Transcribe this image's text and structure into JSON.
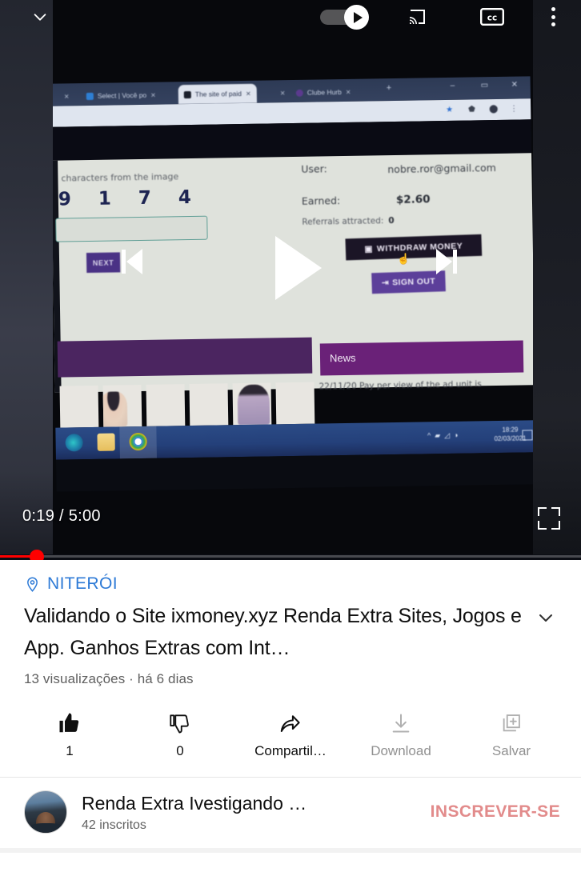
{
  "player": {
    "collapse_icon": "chevron-down-icon",
    "autoplay_label": "autoplay-toggle",
    "cast_icon": "cast-icon",
    "cc_icon": "closed-captions-icon",
    "more_icon": "more-options-icon",
    "prev_icon": "previous-video-icon",
    "play_icon": "play-icon",
    "next_icon": "next-video-icon",
    "current_time": "0:19",
    "duration": "5:00",
    "time_display": "0:19 / 5:00",
    "progress_percent": 6.4,
    "progress_color": "#ff0000",
    "fullscreen_icon": "fullscreen-icon"
  },
  "video_content": {
    "browser": {
      "tabs": [
        {
          "title": "Select | Você po",
          "favicon_color": "#2e7fd4"
        },
        {
          "title": "The site of paid",
          "favicon_color": "#1b1f2b",
          "active": true
        },
        {
          "title": "Clube Hurb",
          "favicon_color": "#5b3a8e"
        }
      ],
      "new_tab_label": "+",
      "window_buttons": [
        "–",
        "❐",
        "✕"
      ],
      "toolbar_icons": [
        "star-icon",
        "extensions-icon",
        "profile-icon",
        "menu-icon"
      ]
    },
    "site": {
      "captcha_prompt": "characters from the image",
      "captcha_digits": "9 1 7 4",
      "next_button": "NEXT",
      "user_label": "User:",
      "user_value": "nobre.ror@gmail.com",
      "earned_label": "Earned:",
      "earned_value": "$2.60",
      "referrals_label": "Referrals attracted:",
      "referrals_value": "0",
      "withdraw_button": "WITHDRAW MONEY",
      "signout_button": "SIGN OUT",
      "news_header": "News",
      "news_text": "22/11/20 Pay per view of the ad unit is"
    },
    "taskbar": {
      "apps": [
        "edge-icon",
        "file-explorer-icon",
        "chrome-icon"
      ],
      "clock_time": "18:29",
      "clock_date": "02/03/2021"
    }
  },
  "meta": {
    "location_icon": "location-pin-icon",
    "location": "NITERÓI",
    "title": "Validando o Site ixmoney.xyz Renda Extra Sites, Jogos e App. Ganhos Extras com Int…",
    "expand_icon": "chevron-down-icon",
    "views": "13 visualizações",
    "separator": "·",
    "published": "há 6 dias",
    "subinfo": "13 visualizações · há 6 dias",
    "link_color": "#2d7ad6"
  },
  "actions": [
    {
      "name": "like",
      "icon": "thumbs-up-icon",
      "label": "1",
      "dim": false
    },
    {
      "name": "dislike",
      "icon": "thumbs-down-icon",
      "label": "0",
      "dim": false
    },
    {
      "name": "share",
      "icon": "share-arrow-icon",
      "label": "Compartil…",
      "dim": false
    },
    {
      "name": "download",
      "icon": "download-icon",
      "label": "Download",
      "dim": true
    },
    {
      "name": "save",
      "icon": "save-plus-icon",
      "label": "Salvar",
      "dim": true
    }
  ],
  "channel": {
    "avatar": "channel-avatar",
    "name": "Renda Extra Ivestigando …",
    "subscribers": "42 inscritos",
    "subscribe_label": "INSCREVER-SE",
    "subscribe_color": "#e28b8b"
  }
}
